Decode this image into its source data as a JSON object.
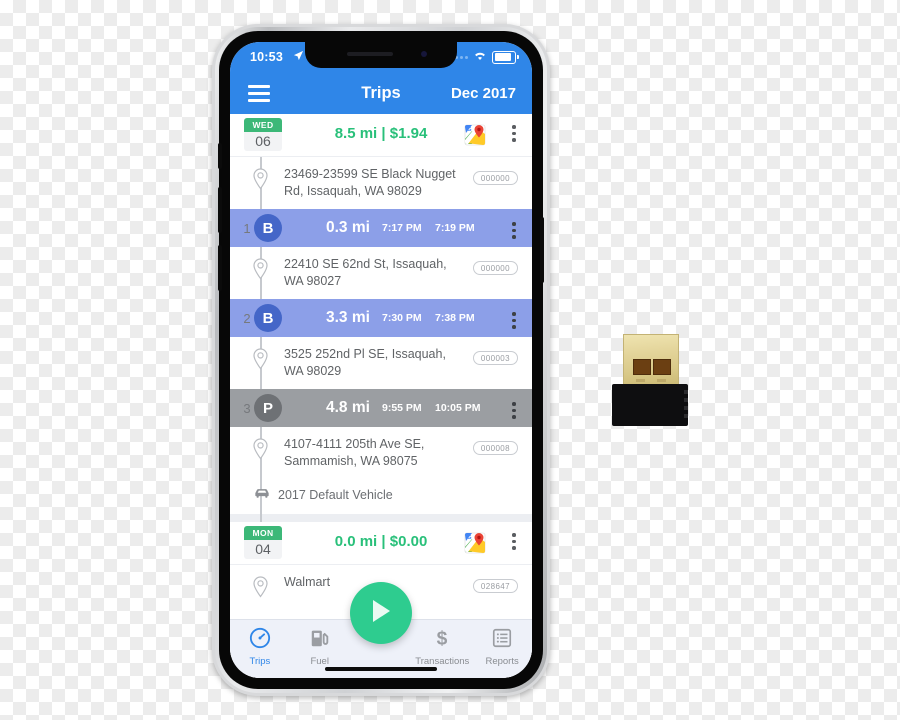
{
  "phone": {
    "status_bar": {
      "time": "10:53",
      "location_arrow_icon": "location-arrow-icon",
      "signal_icon": "signal-dots-icon",
      "wifi_icon": "wifi-icon",
      "battery_icon": "battery-icon"
    },
    "nav_bar": {
      "menu_icon": "hamburger-menu-icon",
      "title": "Trips",
      "month": "Dec 2017"
    },
    "days": [
      {
        "dow": "WED",
        "date": "06",
        "summary": "8.5 mi | $1.94",
        "map_icon": "google-maps-icon",
        "menu_icon": "kebab-menu-icon",
        "start_address": "23469-23599 SE Black Nugget Rd, Issaquah, WA 98029",
        "start_odometer": "000000",
        "trips": [
          {
            "index": "1",
            "badge": "B",
            "type": "business",
            "distance": "0.3 mi",
            "start_time": "7:17 PM",
            "end_time": "7:19 PM",
            "end_address": "22410 SE 62nd St, Issaquah, WA 98027",
            "end_odometer": "000000"
          },
          {
            "index": "2",
            "badge": "B",
            "type": "business",
            "distance": "3.3 mi",
            "start_time": "7:30 PM",
            "end_time": "7:38 PM",
            "end_address": "3525 252nd Pl SE, Issaquah, WA 98029",
            "end_odometer": "000003"
          },
          {
            "index": "3",
            "badge": "P",
            "type": "personal",
            "distance": "4.8 mi",
            "start_time": "9:55 PM",
            "end_time": "10:05 PM",
            "end_address": "4107-4111 205th Ave SE, Sammamish, WA 98075",
            "end_odometer": "000008"
          }
        ],
        "vehicle_icon": "car-icon",
        "vehicle": "2017 Default Vehicle"
      },
      {
        "dow": "MON",
        "date": "04",
        "summary": "0.0 mi | $0.00",
        "map_icon": "google-maps-icon",
        "menu_icon": "kebab-menu-icon",
        "start_address": "Walmart",
        "start_odometer": "028647"
      }
    ],
    "fab": {
      "icon": "play-icon",
      "color": "#2ecc8f"
    },
    "tab_bar": {
      "tabs": [
        {
          "label": "Trips",
          "icon": "speedometer-icon",
          "active": true
        },
        {
          "label": "Fuel",
          "icon": "fuel-pump-icon",
          "active": false
        },
        {
          "label": "Transactions",
          "icon": "dollar-sign-icon",
          "active": false
        },
        {
          "label": "Reports",
          "icon": "list-report-icon",
          "active": false
        }
      ]
    }
  },
  "usb_device": {
    "name": "usb-dongle",
    "label": ""
  },
  "colors": {
    "nav_blue": "#2f86e8",
    "summary_green": "#29c07a",
    "business_row": "#8c9fe8",
    "personal_row": "#9b9ea2",
    "fab_green": "#2ecc8f",
    "badge_green": "#3cb878"
  }
}
